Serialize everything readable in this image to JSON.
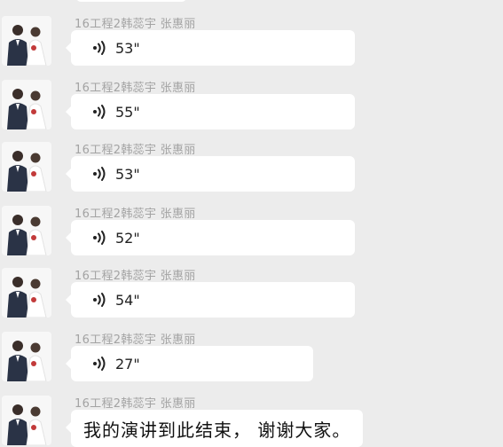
{
  "chat": {
    "messages": [
      {
        "sender": "16工程2韩蕊宇 张惠丽",
        "type": "voice",
        "duration": "53\""
      },
      {
        "sender": "16工程2韩蕊宇 张惠丽",
        "type": "voice",
        "duration": "55\""
      },
      {
        "sender": "16工程2韩蕊宇 张惠丽",
        "type": "voice",
        "duration": "53\""
      },
      {
        "sender": "16工程2韩蕊宇 张惠丽",
        "type": "voice",
        "duration": "52\""
      },
      {
        "sender": "16工程2韩蕊宇 张惠丽",
        "type": "voice",
        "duration": "54\""
      },
      {
        "sender": "16工程2韩蕊宇 张惠丽",
        "type": "voice",
        "duration": "27\""
      },
      {
        "sender": "16工程2韩蕊宇 张惠丽",
        "type": "text",
        "text": "我的演讲到此结束， 谢谢大家。"
      }
    ]
  },
  "icons": {
    "voice": "voice-wave-icon",
    "avatar": "couple-avatar"
  },
  "colors": {
    "background": "#ececec",
    "bubble": "#ffffff",
    "sender_text": "#a3a3a3",
    "message_text": "#111111"
  }
}
